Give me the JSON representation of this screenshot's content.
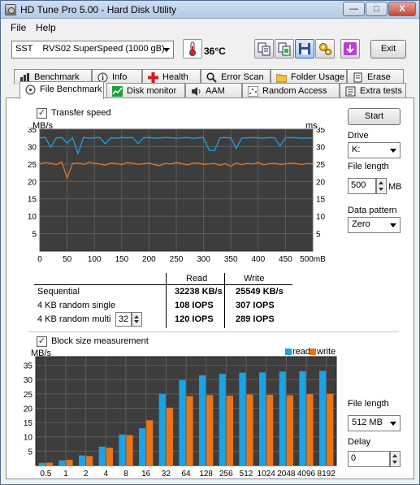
{
  "window": {
    "title": "HD Tune Pro 5.00 - Hard Disk Utility",
    "controls": {
      "minimize": "—",
      "maximize": "□",
      "close": "X"
    }
  },
  "menu": {
    "file": "File",
    "help": "Help"
  },
  "toolbar": {
    "drive": "SST    RVS02 SuperSpeed (1000 gB)",
    "temperature": "36°C",
    "exit": "Exit",
    "icons": [
      "thermometer-icon",
      "copy-text-icon",
      "copy-screenshot-icon",
      "save-icon",
      "options-icon",
      "download-icon"
    ]
  },
  "tabs": {
    "row1": [
      {
        "label": "Benchmark",
        "icon": "benchmark-icon"
      },
      {
        "label": "Info",
        "icon": "info-icon"
      },
      {
        "label": "Health",
        "icon": "health-icon"
      },
      {
        "label": "Error Scan",
        "icon": "error-scan-icon"
      },
      {
        "label": "Folder Usage",
        "icon": "folder-icon"
      },
      {
        "label": "Erase",
        "icon": "erase-icon"
      }
    ],
    "row2": [
      {
        "label": "File Benchmark",
        "icon": "file-benchmark-icon"
      },
      {
        "label": "Disk monitor",
        "icon": "disk-monitor-icon"
      },
      {
        "label": "AAM",
        "icon": "speaker-icon"
      },
      {
        "label": "Random Access",
        "icon": "random-access-icon"
      },
      {
        "label": "Extra tests",
        "icon": "extra-tests-icon"
      }
    ]
  },
  "transfer": {
    "checkbox_label": "Transfer speed",
    "checked": true,
    "mark": "✓",
    "left_unit": "MB/s",
    "right_unit": "ms",
    "x_unit": "mB",
    "y_ticks": [
      35,
      30,
      25,
      20,
      15,
      10,
      5
    ],
    "x_ticks": [
      0,
      50,
      100,
      150,
      200,
      250,
      300,
      350,
      400,
      450,
      500
    ],
    "read_color": "#1aa3e6",
    "write_color": "#e8751a"
  },
  "results": {
    "read_header": "Read",
    "write_header": "Write",
    "rows": [
      {
        "label": "Sequential",
        "read": "32238 KB/s",
        "write": "25549 KB/s"
      },
      {
        "label": "4 KB random single",
        "read": "108 IOPS",
        "write": "307 IOPS"
      },
      {
        "label": "4 KB random multi",
        "read": "120 IOPS",
        "write": "289 IOPS"
      }
    ],
    "queue_depth": "32"
  },
  "side": {
    "start": "Start",
    "drive_label": "Drive",
    "drive_value": "K:",
    "file_length_label": "File length",
    "file_length_value": "500",
    "file_length_unit": "MB",
    "pattern_label": "Data pattern",
    "pattern_value": "Zero"
  },
  "block": {
    "checkbox_label": "Block size measurement",
    "checked": true,
    "mark": "✓",
    "unit": "MB/s",
    "legend_read": "read",
    "legend_write": "write",
    "y_ticks": [
      35,
      30,
      25,
      20,
      15,
      10,
      5
    ]
  },
  "block_side": {
    "file_length_label": "File length",
    "file_length_value": "512 MB",
    "delay_label": "Delay",
    "delay_value": "0"
  },
  "chart_data": [
    {
      "type": "line",
      "title": "",
      "xlabel": "mB",
      "ylabel": "MB/s",
      "xlim": [
        0,
        500
      ],
      "ylim": [
        0,
        35
      ],
      "series": [
        {
          "name": "Read",
          "x": [
            0,
            10,
            20,
            30,
            40,
            50,
            60,
            70,
            80,
            90,
            100,
            110,
            120,
            130,
            140,
            150,
            160,
            170,
            180,
            190,
            200,
            210,
            220,
            230,
            240,
            250,
            260,
            270,
            280,
            290,
            300,
            310,
            320,
            330,
            340,
            350,
            360,
            370,
            380,
            390,
            400,
            410,
            420,
            430,
            440,
            450,
            460,
            470,
            480,
            490,
            500
          ],
          "values": [
            32.5,
            32.6,
            29.8,
            32.5,
            32.6,
            31.0,
            32.5,
            28.0,
            32.6,
            32.4,
            32.5,
            32.6,
            30.8,
            32.5,
            32.4,
            32.6,
            32.5,
            32.6,
            30.9,
            32.5,
            32.6,
            32.4,
            32.5,
            32.6,
            32.5,
            32.4,
            32.5,
            32.6,
            32.4,
            32.5,
            32.6,
            29.0,
            28.8,
            32.5,
            32.6,
            32.5,
            29.5,
            32.4,
            32.5,
            32.6,
            32.5,
            32.4,
            32.6,
            32.5,
            30.2,
            32.5,
            32.6,
            32.5,
            32.4,
            32.5,
            32.4
          ]
        },
        {
          "name": "Write",
          "x": [
            0,
            10,
            20,
            30,
            40,
            50,
            60,
            70,
            80,
            90,
            100,
            110,
            120,
            130,
            140,
            150,
            160,
            170,
            180,
            190,
            200,
            210,
            220,
            230,
            240,
            250,
            260,
            270,
            280,
            290,
            300,
            310,
            320,
            330,
            340,
            350,
            360,
            370,
            380,
            390,
            400,
            410,
            420,
            430,
            440,
            450,
            460,
            470,
            480,
            490,
            500
          ],
          "values": [
            25.0,
            25.4,
            25.2,
            24.8,
            25.6,
            21.0,
            25.1,
            25.3,
            24.9,
            25.5,
            25.2,
            25.0,
            24.6,
            25.3,
            25.1,
            24.8,
            25.4,
            25.2,
            24.9,
            25.1,
            25.3,
            24.8,
            24.5,
            25.2,
            25.0,
            25.4,
            25.1,
            24.7,
            25.2,
            25.3,
            24.9,
            25.0,
            25.2,
            24.6,
            25.1,
            24.3,
            25.3,
            24.8,
            25.2,
            25.0,
            25.4,
            24.7,
            25.1,
            25.2,
            24.9,
            25.0,
            25.3,
            25.1,
            24.8,
            25.2,
            25.0
          ]
        }
      ]
    },
    {
      "type": "bar",
      "title": "",
      "ylabel": "MB/s",
      "ylim": [
        0,
        38
      ],
      "categories": [
        "0.5",
        "1",
        "2",
        "4",
        "8",
        "16",
        "32",
        "64",
        "128",
        "256",
        "512",
        "1024",
        "2048",
        "4096",
        "8192"
      ],
      "series": [
        {
          "name": "read",
          "values": [
            0.9,
            1.8,
            3.5,
            6.6,
            10.8,
            13.0,
            25.0,
            29.8,
            31.5,
            32.0,
            32.4,
            32.5,
            32.8,
            32.9,
            33.0
          ]
        },
        {
          "name": "write",
          "values": [
            1.0,
            2.0,
            3.3,
            6.2,
            10.6,
            15.8,
            20.2,
            24.2,
            24.6,
            24.4,
            24.8,
            24.7,
            24.5,
            24.9,
            25.0
          ]
        }
      ]
    }
  ]
}
